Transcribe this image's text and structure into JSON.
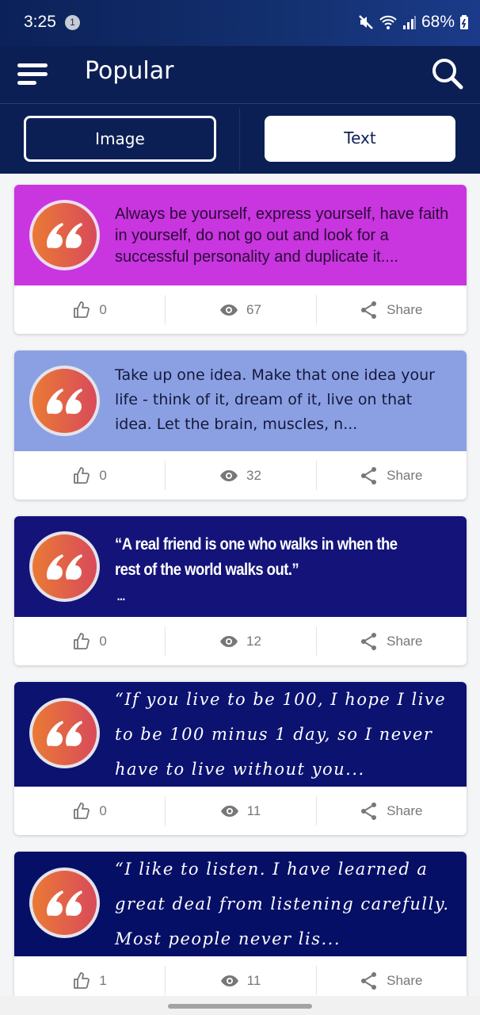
{
  "status_bar": {
    "time": "3:25",
    "notification_count": "1",
    "battery": "68%"
  },
  "app_bar": {
    "title": "Popular"
  },
  "tabs": {
    "image_label": "Image",
    "text_label": "Text",
    "active": "Text"
  },
  "cards": [
    {
      "quote": "Always be yourself, express yourself, have faith in yourself, do not go out and look for a successful personality and duplicate it....",
      "bg_color": "#c935de",
      "text_color": "#2a0a3a",
      "likes": "0",
      "views": "67",
      "share_label": "Share"
    },
    {
      "quote": "Take up one idea. Make that one idea your life - think of it, dream of it, live on that idea. Let the brain, muscles, n...",
      "bg_color": "#8ba0e3",
      "text_color": "#14183a",
      "likes": "0",
      "views": "32",
      "share_label": "Share"
    },
    {
      "quote": "“A real friend is one who walks in when the rest of the world walks out.”",
      "quote_ellipsis": "...",
      "bg_color": "#13137a",
      "text_color": "#ffffff",
      "likes": "0",
      "views": "12",
      "share_label": "Share"
    },
    {
      "quote": "“If you live to be 100, I hope I live to be 100 minus 1 day, so I never have to live without you...",
      "bg_color": "#0b1270",
      "text_color": "#ffffff",
      "likes": "0",
      "views": "11",
      "share_label": "Share"
    },
    {
      "quote": "“I like to listen. I have learned a great deal from listening carefully. Most people never lis...",
      "bg_color": "#060f66",
      "text_color": "#ffffff",
      "likes": "1",
      "views": "11",
      "share_label": "Share"
    }
  ],
  "icons": {
    "menu": "menu-icon",
    "search": "search-icon",
    "quote": "quote-icon",
    "like": "thumbs-up-icon",
    "views": "eye-icon",
    "share": "share-icon"
  }
}
